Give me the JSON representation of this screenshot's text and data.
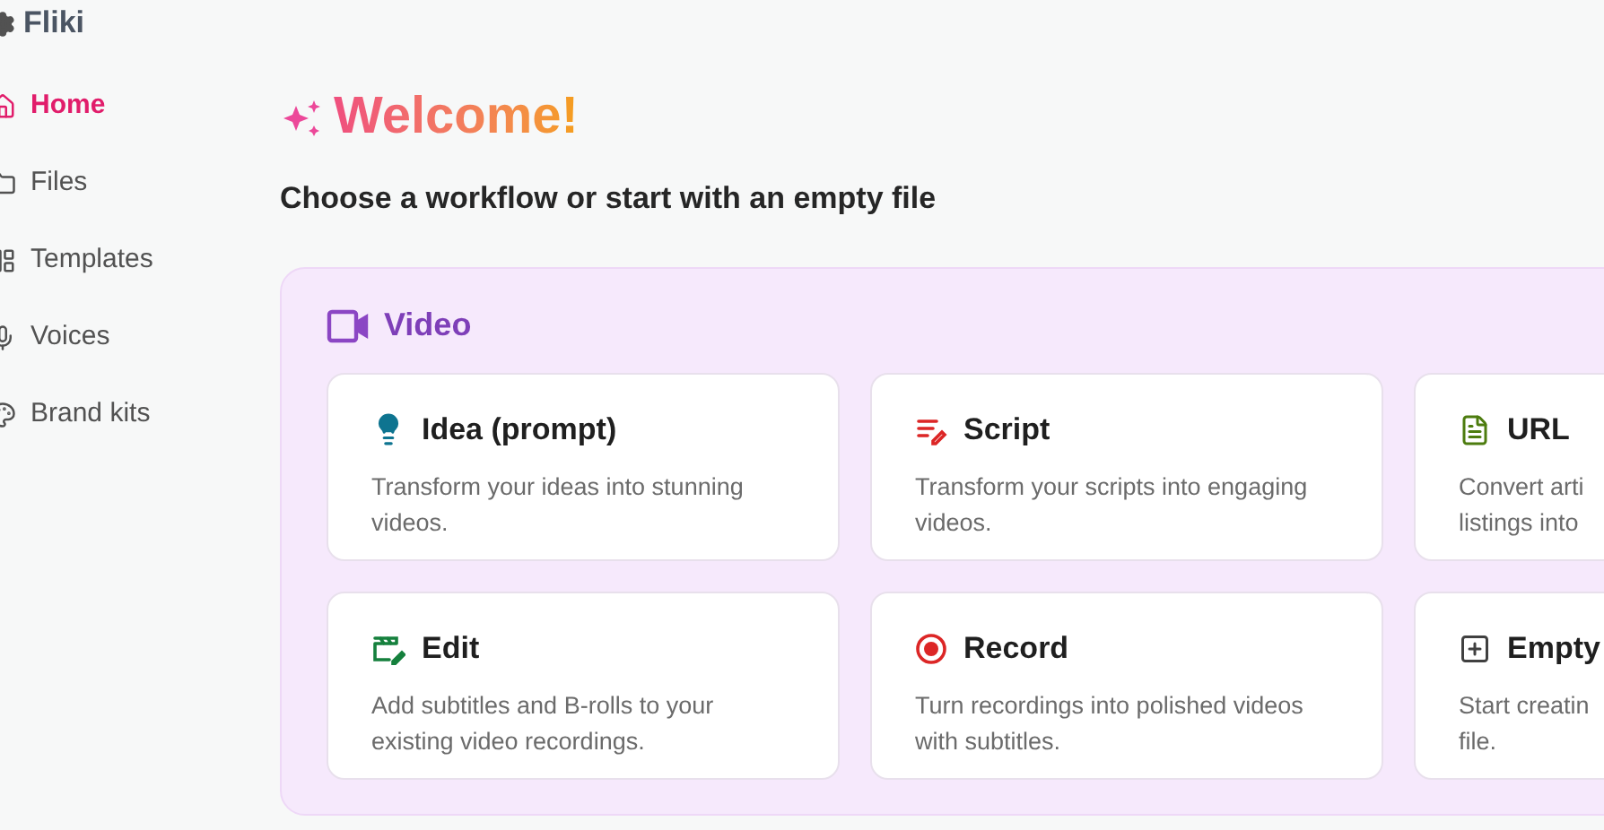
{
  "brand": {
    "name": "Fliki"
  },
  "sidebar": {
    "items": [
      {
        "label": "Home",
        "selected": true
      },
      {
        "label": "Files",
        "selected": false
      },
      {
        "label": "Templates",
        "selected": false
      },
      {
        "label": "Voices",
        "selected": false
      },
      {
        "label": "Brand kits",
        "selected": false
      }
    ]
  },
  "header": {
    "title": "Welcome!",
    "subtitle": "Choose a workflow or start with an empty file"
  },
  "section": {
    "title": "Video",
    "cards": [
      {
        "title": "Idea (prompt)",
        "description": "Transform your ideas into stunning videos."
      },
      {
        "title": "Script",
        "description": "Transform your scripts into engaging videos."
      },
      {
        "title": "URL",
        "description": "Convert arti\nlistings into"
      },
      {
        "title": "Edit",
        "description": "Add subtitles and B-rolls to your existing video recordings."
      },
      {
        "title": "Record",
        "description": "Turn recordings into polished videos with subtitles."
      },
      {
        "title": "Empty",
        "description": "Start creatin\nfile."
      }
    ]
  }
}
